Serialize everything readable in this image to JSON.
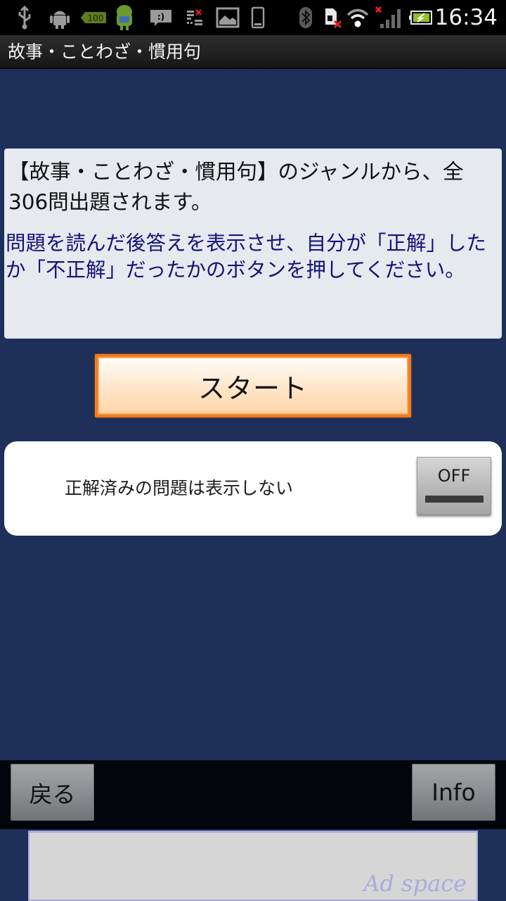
{
  "status_bar": {
    "left_icons": [
      "usb-icon",
      "android-debug-icon",
      "battery-100-icon",
      "android-app-icon",
      "message-icon",
      "list-error-icon",
      "image-icon",
      "phone-icon"
    ],
    "right_icons": [
      "bluetooth-icon",
      "sim-missing-icon",
      "wifi-icon",
      "signal-no-service-icon",
      "battery-charging-icon"
    ],
    "battery_badge": "100",
    "time": "16:34"
  },
  "title_bar": {
    "title": "故事・ことわざ・慣用句"
  },
  "info_box": {
    "main_text": "【故事・ことわざ・慣用句】のジャンルから、全306問出題されます。",
    "instruction_text": "問題を読んだ後答えを表示させ、自分が「正解」したか「不正解」だったかのボタンを押してください。",
    "total_questions": 306
  },
  "start_button": {
    "label": "スタート"
  },
  "toggle": {
    "label": "正解済みの問題は表示しない",
    "state": "OFF"
  },
  "bottom_bar": {
    "back_label": "戻る",
    "info_label": "Info"
  },
  "ad": {
    "label": "Ad space"
  },
  "colors": {
    "background": "#1e2f5a",
    "start_border": "#f07a1a",
    "instruction_text": "#13137a",
    "ad_text": "#a9acdb"
  }
}
